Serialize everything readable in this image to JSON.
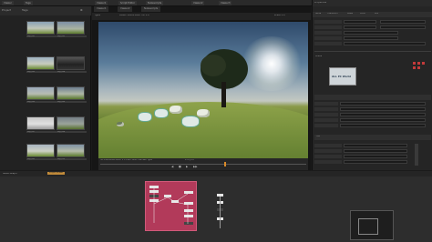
{
  "topbar": {
    "tabs": [
      "Viewer",
      "Tags",
      "Viewer1",
      "Script Editor",
      "Nukescripts",
      "Viewer2",
      "Viewer3",
      "Properties"
    ]
  },
  "bin": {
    "tabs": [
      "Project",
      "Tags"
    ],
    "clips": [
      "clip_001",
      "clip_002",
      "clip_003",
      "clip_004",
      "clip_005",
      "clip_006",
      "clip_007",
      "clip_008",
      "clip_009",
      "clip_010",
      "clip_011",
      "clip_012"
    ]
  },
  "viewer": {
    "tabs": [
      "Viewer1",
      "Viewer2",
      "Nukescripts"
    ],
    "info_bar": "RGBA  1920x1080  HD  1.0",
    "channel": "rgba",
    "zoom": "scale 1.0",
    "status": "HD 1920x1080  bbox: 0 0 1920 1080 channels: rgba",
    "frame": "x=0 y=0"
  },
  "props": {
    "title": "Properties",
    "tabs": [
      "Node",
      "Transform",
      "Mask",
      "Color",
      "Mix"
    ],
    "logo_text": "ALL PC World",
    "section_label": "Grade",
    "mix_label": "mix"
  },
  "dag": {
    "tabs": [
      "Node Graph",
      "Dope Sheet"
    ]
  },
  "colors": {
    "node_group": "#b23a5a",
    "accent_red": "#c23a3a"
  },
  "icons": [
    "play-icon",
    "stop-icon",
    "prev-frame-icon",
    "next-frame-icon",
    "gear-icon"
  ]
}
